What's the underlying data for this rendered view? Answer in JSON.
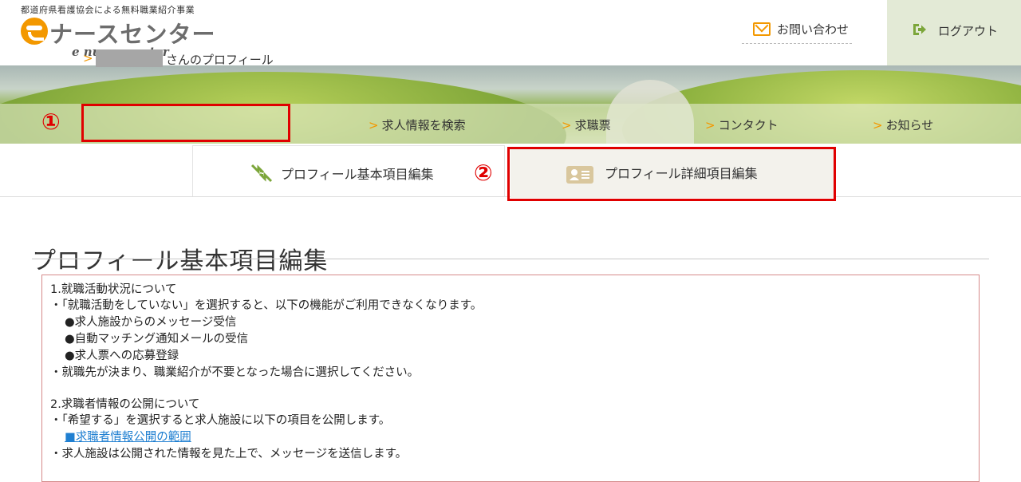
{
  "header": {
    "tagline": "都道府県看護協会による無料職業紹介事業",
    "logo_text": "ナースセンター",
    "logo_sub": "e nurse center",
    "inquiry_label": "お問い合わせ",
    "logout_label": "ログアウト"
  },
  "nav": {
    "items": [
      {
        "label": "さんのプロフィール"
      },
      {
        "label": "求人情報を検索"
      },
      {
        "label": "求職票"
      },
      {
        "label": "コンタクト"
      },
      {
        "label": "お知らせ"
      }
    ],
    "chevron": ">"
  },
  "annotations": {
    "one": "①",
    "two": "②"
  },
  "tabs": {
    "basic": "プロフィール基本項目編集",
    "detail": "プロフィール詳細項目編集"
  },
  "page_title": "プロフィール基本項目編集",
  "notice": {
    "s1_title": "1.就職活動状況について",
    "s1_line1": "・「就職活動をしていない」を選択すると、以下の機能がご利用できなくなります。",
    "s1_b1": "●求人施設からのメッセージ受信",
    "s1_b2": "●自動マッチング通知メールの受信",
    "s1_b3": "●求人票への応募登録",
    "s1_line2": "・就職先が決まり、職業紹介が不要となった場合に選択してください。",
    "s2_title": "2.求職者情報の公開について",
    "s2_line1": "・「希望する」を選択すると求人施設に以下の項目を公開します。",
    "s2_link": "■求職者情報公開の範囲",
    "s2_line2": "・求人施設は公開された情報を見た上で、メッセージを送信します。"
  },
  "colors": {
    "accent": "#f39800",
    "highlight": "#e00000",
    "link": "#1f7fd1"
  }
}
